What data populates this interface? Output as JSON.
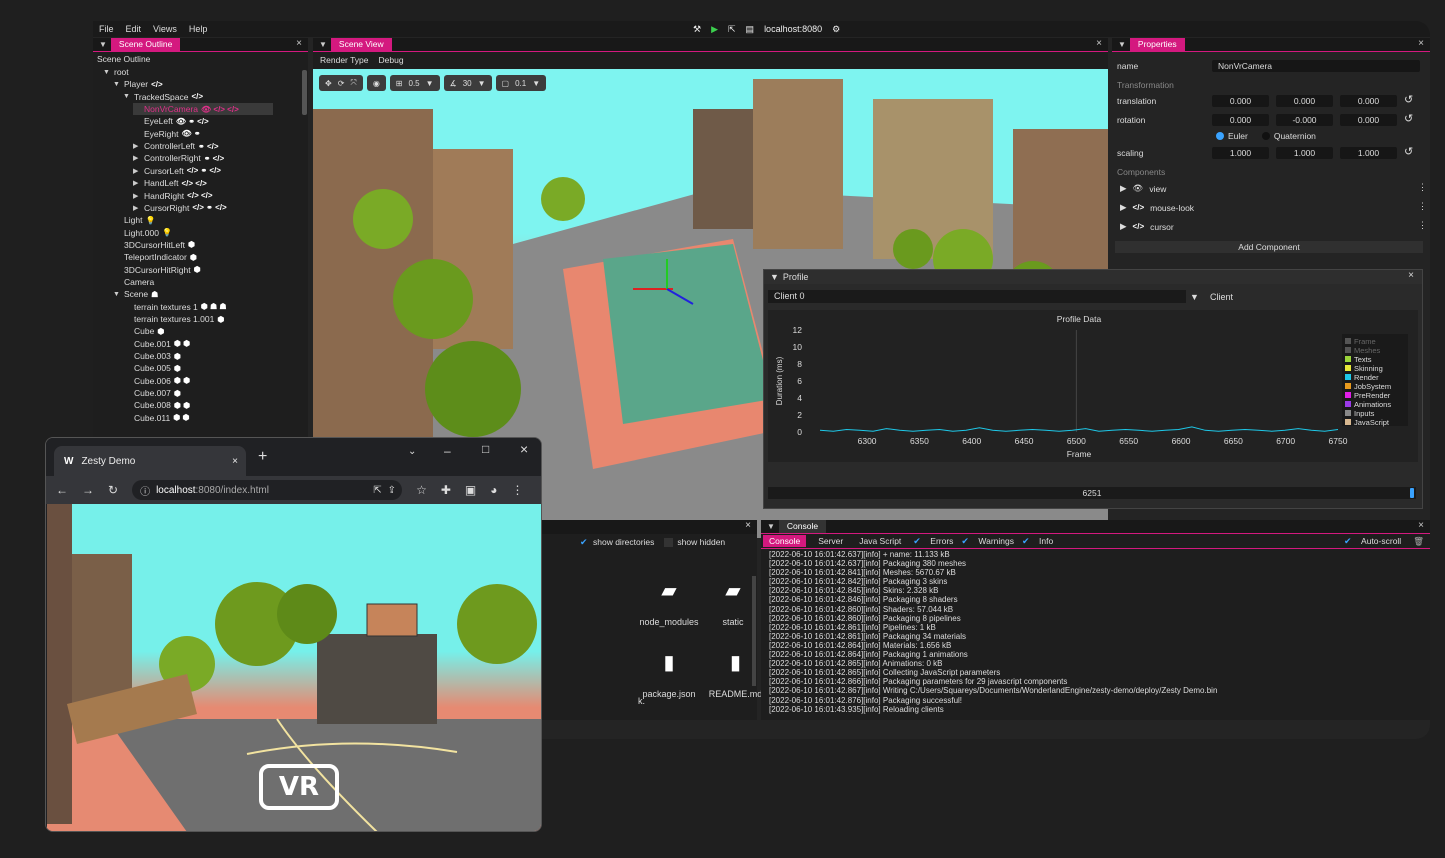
{
  "menu": {
    "items": [
      "File",
      "Edit",
      "Views",
      "Help"
    ],
    "server": "localhost:8080"
  },
  "scene_outline": {
    "tab": "Scene Outline",
    "header": "Scene Outline",
    "nodes": [
      {
        "label": "root",
        "depth": 0,
        "arrow": "▼"
      },
      {
        "label": "Player",
        "depth": 1,
        "arrow": "▼",
        "icons": "</>"
      },
      {
        "label": "TrackedSpace",
        "depth": 2,
        "arrow": "▼",
        "icons": "</>"
      },
      {
        "label": "NonVrCamera",
        "depth": 3,
        "arrow": "",
        "icons": "👁 </> </>",
        "selected": true
      },
      {
        "label": "EyeLeft",
        "depth": 3,
        "arrow": "",
        "icons": "👁 ⚭ </>"
      },
      {
        "label": "EyeRight",
        "depth": 3,
        "arrow": "",
        "icons": "👁 ⚭"
      },
      {
        "label": "ControllerLeft",
        "depth": 3,
        "arrow": "▶",
        "icons": "⚭ </>"
      },
      {
        "label": "ControllerRight",
        "depth": 3,
        "arrow": "▶",
        "icons": "⚭ </>"
      },
      {
        "label": "CursorLeft",
        "depth": 3,
        "arrow": "▶",
        "icons": "</> ⚭ </>"
      },
      {
        "label": "HandLeft",
        "depth": 3,
        "arrow": "▶",
        "icons": "</> </>"
      },
      {
        "label": "HandRight",
        "depth": 3,
        "arrow": "▶",
        "icons": "</> </>"
      },
      {
        "label": "CursorRight",
        "depth": 3,
        "arrow": "▶",
        "icons": "</> ⚭ </>"
      },
      {
        "label": "Light",
        "depth": 1,
        "arrow": "",
        "icons": "💡"
      },
      {
        "label": "Light.000",
        "depth": 1,
        "arrow": "",
        "icons": "💡"
      },
      {
        "label": "3DCursorHitLeft",
        "depth": 1,
        "arrow": "",
        "icons": "⬢"
      },
      {
        "label": "TeleportIndicator",
        "depth": 1,
        "arrow": "",
        "icons": "⬢"
      },
      {
        "label": "3DCursorHitRight",
        "depth": 1,
        "arrow": "",
        "icons": "⬢"
      },
      {
        "label": "Camera",
        "depth": 1,
        "arrow": "",
        "icons": ""
      },
      {
        "label": "Scene",
        "depth": 1,
        "arrow": "▼",
        "icons": "☗"
      },
      {
        "label": "terrain textures 1",
        "depth": 2,
        "arrow": "",
        "icons": "⬢ ☗ ☗"
      },
      {
        "label": "terrain textures 1.001",
        "depth": 2,
        "arrow": "",
        "icons": "⬢"
      },
      {
        "label": "Cube",
        "depth": 2,
        "arrow": "",
        "icons": "⬢"
      },
      {
        "label": "Cube.001",
        "depth": 2,
        "arrow": "",
        "icons": "⬢ ⬢"
      },
      {
        "label": "Cube.003",
        "depth": 2,
        "arrow": "",
        "icons": "⬢"
      },
      {
        "label": "Cube.005",
        "depth": 2,
        "arrow": "",
        "icons": "⬢"
      },
      {
        "label": "Cube.006",
        "depth": 2,
        "arrow": "",
        "icons": "⬢ ⬢"
      },
      {
        "label": "Cube.007",
        "depth": 2,
        "arrow": "",
        "icons": "⬢"
      },
      {
        "label": "Cube.008",
        "depth": 2,
        "arrow": "",
        "icons": "⬢ ⬢"
      },
      {
        "label": "Cube.011",
        "depth": 2,
        "arrow": "",
        "icons": "⬢ ⬢"
      }
    ]
  },
  "scene_view": {
    "tab": "Scene View",
    "render_type": "Render Type",
    "debug": "Debug",
    "grid": "0.5",
    "rot": "30",
    "scale": "0.1"
  },
  "properties": {
    "tab": "Properties",
    "name_label": "name",
    "name_value": "NonVrCamera",
    "transformation": "Transformation",
    "translation_label": "translation",
    "translation": [
      "0.000",
      "0.000",
      "0.000"
    ],
    "rotation_label": "rotation",
    "rotation": [
      "0.000",
      "-0.000",
      "0.000"
    ],
    "euler": "Euler",
    "quaternion": "Quaternion",
    "scaling_label": "scaling",
    "scaling": [
      "1.000",
      "1.000",
      "1.000"
    ],
    "components_label": "Components",
    "components": [
      "view",
      "mouse-look",
      "cursor"
    ],
    "add_component": "Add Component"
  },
  "profile": {
    "tab": "Profile",
    "client_select": "Client 0",
    "client_label": "Client",
    "slider_value": "6251"
  },
  "chart_data": {
    "type": "line",
    "title": "Profile Data",
    "xlabel": "Frame",
    "ylabel": "Duration (ms)",
    "xlim": [
      6255,
      6750
    ],
    "ylim": [
      0,
      12
    ],
    "x_ticks": [
      6300,
      6350,
      6400,
      6450,
      6500,
      6550,
      6600,
      6650,
      6700,
      6750
    ],
    "y_ticks": [
      0,
      2,
      4,
      6,
      8,
      10,
      12
    ],
    "legend": [
      {
        "name": "Frame",
        "color": "#555555"
      },
      {
        "name": "Meshes",
        "color": "#555555"
      },
      {
        "name": "Texts",
        "color": "#9bd53a"
      },
      {
        "name": "Skinning",
        "color": "#e8e83a"
      },
      {
        "name": "Render",
        "color": "#1ec8e8"
      },
      {
        "name": "JobSystem",
        "color": "#e89a1e"
      },
      {
        "name": "PreRender",
        "color": "#e01ee8"
      },
      {
        "name": "Animations",
        "color": "#9a3ae8"
      },
      {
        "name": "Inputs",
        "color": "#888888"
      },
      {
        "name": "JavaScript",
        "color": "#d8b890"
      }
    ],
    "series": [
      {
        "name": "Render",
        "values": [
          0.2,
          0.1,
          0.3,
          0.2,
          0.1,
          0.4,
          0.2,
          0.1,
          0.2,
          0.3,
          0.1,
          0.2,
          0.5,
          0.2,
          0.1,
          0.2,
          0.3,
          0.2,
          0.1,
          0.2,
          0.4,
          0.1,
          0.2,
          0.3,
          0.2,
          0.1,
          0.2,
          0.3,
          0.6,
          0.2,
          0.1,
          0.2,
          0.3,
          0.2,
          0.1,
          0.2,
          0.4,
          0.2,
          0.1,
          0.3
        ]
      }
    ]
  },
  "filebrowser": {
    "show_directories": "show directories",
    "show_hidden": "show hidden",
    "files": [
      {
        "name": "node_modules",
        "icon": "folder-icon"
      },
      {
        "name": "static",
        "icon": "folder-icon"
      },
      {
        "name": "package.json",
        "icon": "file-icon"
      },
      {
        "name": "README.md",
        "icon": "file-icon"
      }
    ],
    "cut": "k."
  },
  "console": {
    "tab": "Console",
    "tabs": [
      "Console",
      "Server",
      "Java Script"
    ],
    "filters": [
      "Errors",
      "Warnings",
      "Info"
    ],
    "autoscroll": "Auto-scroll",
    "lines": [
      "[2022-06-10 16:01:42.637][info]  + name:     11.133 kB",
      "[2022-06-10 16:01:42.637][info] Packaging 380 meshes",
      "[2022-06-10 16:01:42.841][info] Meshes: 5670.67 kB",
      "[2022-06-10 16:01:42.842][info] Packaging 3 skins",
      "[2022-06-10 16:01:42.845][info] Skins: 2.328 kB",
      "[2022-06-10 16:01:42.846][info] Packaging 8 shaders",
      "[2022-06-10 16:01:42.860][info] Shaders: 57.044 kB",
      "[2022-06-10 16:01:42.860][info] Packaging 8 pipelines",
      "[2022-06-10 16:01:42.861][info] Pipelines: 1 kB",
      "[2022-06-10 16:01:42.861][info] Packaging 34 materials",
      "[2022-06-10 16:01:42.864][info] Materials: 1.656 kB",
      "[2022-06-10 16:01:42.864][info] Packaging 1 animations",
      "[2022-06-10 16:01:42.865][info] Animations: 0 kB",
      "[2022-06-10 16:01:42.865][info] Collecting JavaScript parameters",
      "[2022-06-10 16:01:42.866][info] Packaging parameters for 29 javascript components",
      "[2022-06-10 16:01:42.867][info] Writing C:/Users/Squareys/Documents/WonderlandEngine/zesty-demo/deploy/Zesty Demo.bin",
      "[2022-06-10 16:01:42.876][info] Packaging successful!",
      "[2022-06-10 16:01:43.935][info] Reloading clients"
    ]
  },
  "browser": {
    "tab_title": "Zesty Demo",
    "url_host": "localhost",
    "url_rest": ":8080/index.html",
    "vr_label": "VR"
  }
}
